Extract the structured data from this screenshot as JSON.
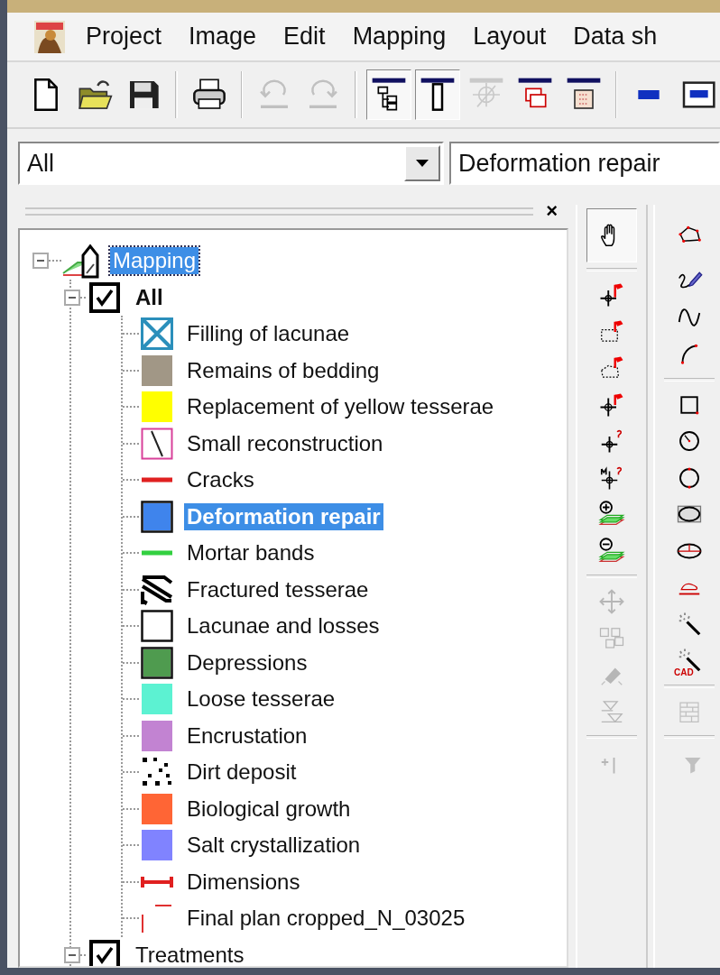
{
  "menu": [
    {
      "label": "Project"
    },
    {
      "label": "Image"
    },
    {
      "label": "Edit"
    },
    {
      "label": "Mapping"
    },
    {
      "label": "Layout"
    },
    {
      "label": "Data sh"
    }
  ],
  "toolbar": [
    {
      "kind": "new",
      "pressed": false,
      "disabled": false
    },
    {
      "kind": "open",
      "pressed": false,
      "disabled": false
    },
    {
      "kind": "save",
      "pressed": false,
      "disabled": false
    },
    {
      "kind": "separator"
    },
    {
      "kind": "print",
      "pressed": false,
      "disabled": false
    },
    {
      "kind": "separator"
    },
    {
      "kind": "undo",
      "pressed": false,
      "disabled": true
    },
    {
      "kind": "redo",
      "pressed": false,
      "disabled": true
    },
    {
      "kind": "separator"
    },
    {
      "kind": "tree",
      "pressed": true,
      "disabled": false
    },
    {
      "kind": "panel",
      "pressed": true,
      "disabled": false
    },
    {
      "kind": "crosshair",
      "pressed": false,
      "disabled": true
    },
    {
      "kind": "layerwin",
      "pressed": false,
      "disabled": false
    },
    {
      "kind": "gridwin",
      "pressed": false,
      "disabled": false
    },
    {
      "kind": "separator"
    },
    {
      "kind": "bar",
      "pressed": false,
      "disabled": false
    },
    {
      "kind": "window",
      "pressed": false,
      "disabled": false
    }
  ],
  "panel": {
    "close": "×"
  },
  "combos": [
    {
      "value": "All"
    },
    {
      "value": "Deformation repair"
    }
  ],
  "tree": {
    "label": "Mapping",
    "focused": true,
    "expanded": true,
    "children": [
      {
        "label": "All",
        "checked": true,
        "expanded": true,
        "children": [
          {
            "label": "Filling of lacunae",
            "kind": "cross",
            "color": "#2b8fbb",
            "selected": false
          },
          {
            "label": "Remains of bedding",
            "kind": "fill",
            "color": "#a19786",
            "selected": false
          },
          {
            "label": "Replacement of yellow tesserae",
            "kind": "fill",
            "color": "#ffff00",
            "selected": false
          },
          {
            "label": "Small reconstruction",
            "kind": "slash",
            "color": "#d8409a",
            "selected": false
          },
          {
            "label": "Cracks",
            "kind": "line",
            "color": "#e02020",
            "selected": false
          },
          {
            "label": "Deformation repair",
            "kind": "framed",
            "color": "#3f84ec",
            "selected": true
          },
          {
            "label": "Mortar bands",
            "kind": "line",
            "color": "#33d040",
            "selected": false
          },
          {
            "label": "Fractured tesserae",
            "kind": "hatch",
            "color": "#000000",
            "selected": false
          },
          {
            "label": "Lacunae and losses",
            "kind": "framed",
            "color": "#ffffff",
            "selected": false
          },
          {
            "label": "Depressions",
            "kind": "framed",
            "color": "#4f9b4f",
            "selected": false
          },
          {
            "label": "Loose tesserae",
            "kind": "fill",
            "color": "#5cf2d2",
            "selected": false
          },
          {
            "label": "Encrustation",
            "kind": "fill",
            "color": "#c283d2",
            "selected": false
          },
          {
            "label": "Dirt deposit",
            "kind": "dots",
            "color": "#000000",
            "selected": false
          },
          {
            "label": "Biological growth",
            "kind": "fill",
            "color": "#ff6535",
            "selected": false
          },
          {
            "label": "Salt crystallization",
            "kind": "fill",
            "color": "#8083ff",
            "selected": false
          },
          {
            "label": "Dimensions",
            "kind": "dimension",
            "color": "#e02020",
            "selected": false
          },
          {
            "label": "Final plan cropped_N_03025",
            "kind": "image",
            "color": "#e03030",
            "selected": false
          }
        ]
      },
      {
        "label": "Treatments",
        "checked": true,
        "expanded": true
      }
    ]
  },
  "palette": [
    [
      {
        "kind": "hand",
        "pressed": true,
        "disabled": false
      },
      {
        "kind": "separator"
      },
      {
        "kind": "pin-point",
        "pressed": false,
        "disabled": false
      },
      {
        "kind": "pin-rect",
        "pressed": false,
        "disabled": false
      },
      {
        "kind": "pin-poly",
        "pressed": false,
        "disabled": false
      },
      {
        "kind": "pin-cross",
        "pressed": false,
        "disabled": false
      },
      {
        "kind": "query",
        "pressed": false,
        "disabled": false
      },
      {
        "kind": "query-cross",
        "pressed": false,
        "disabled": false
      },
      {
        "kind": "layers-plus",
        "pressed": false,
        "disabled": false
      },
      {
        "kind": "layers-minus",
        "pressed": false,
        "disabled": false
      },
      {
        "kind": "separator"
      },
      {
        "kind": "move",
        "pressed": false,
        "disabled": true
      },
      {
        "kind": "group",
        "pressed": false,
        "disabled": true
      },
      {
        "kind": "eraser",
        "pressed": false,
        "disabled": true
      },
      {
        "kind": "triangles",
        "pressed": false,
        "disabled": true
      },
      {
        "kind": "separator"
      },
      {
        "kind": "plus-pin",
        "pressed": false,
        "disabled": true
      }
    ],
    [
      {
        "kind": "polygon",
        "pressed": false,
        "disabled": false
      },
      {
        "kind": "pen",
        "pressed": false,
        "disabled": false
      },
      {
        "kind": "curve",
        "pressed": false,
        "disabled": false
      },
      {
        "kind": "arc",
        "pressed": false,
        "disabled": false
      },
      {
        "kind": "separator"
      },
      {
        "kind": "square",
        "pressed": false,
        "disabled": false
      },
      {
        "kind": "circle-radius",
        "pressed": false,
        "disabled": false
      },
      {
        "kind": "circle",
        "pressed": false,
        "disabled": false
      },
      {
        "kind": "ellipse-frame",
        "pressed": false,
        "disabled": false
      },
      {
        "kind": "ellipse",
        "pressed": false,
        "disabled": false
      },
      {
        "kind": "underline-shape",
        "pressed": false,
        "disabled": false
      },
      {
        "kind": "wand",
        "pressed": false,
        "disabled": false
      },
      {
        "kind": "wand",
        "badge": "CAD",
        "pressed": false,
        "disabled": false
      },
      {
        "kind": "separator"
      },
      {
        "kind": "wall",
        "pressed": false,
        "disabled": true
      },
      {
        "kind": "separator"
      },
      {
        "kind": "funnel",
        "pressed": false,
        "disabled": true
      }
    ]
  ]
}
